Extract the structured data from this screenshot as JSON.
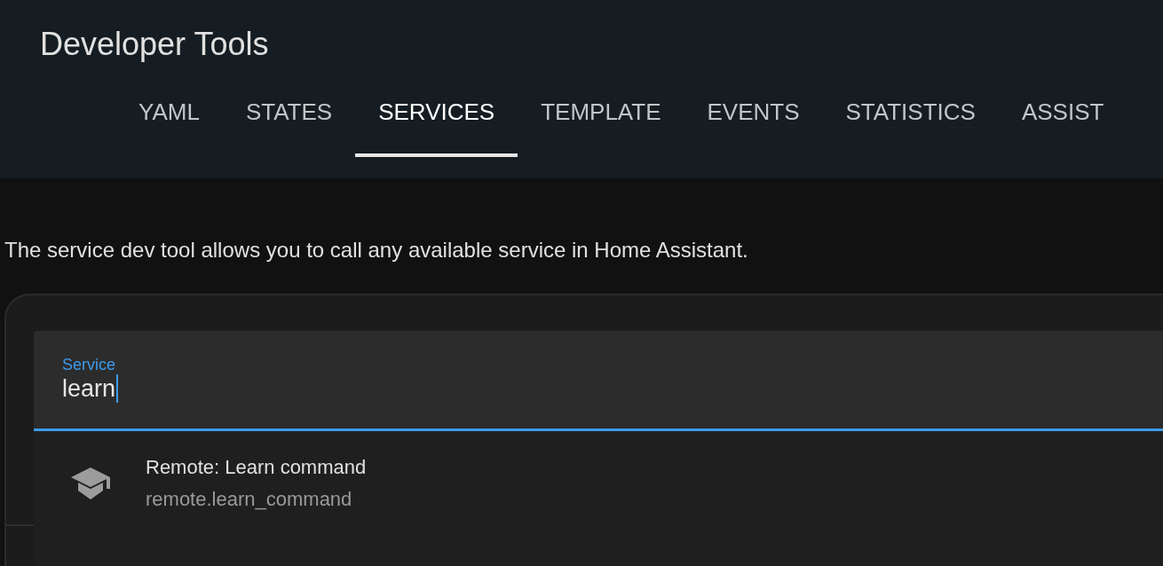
{
  "header": {
    "title": "Developer Tools"
  },
  "tabs": [
    {
      "label": "YAML",
      "selected": false
    },
    {
      "label": "STATES",
      "selected": false
    },
    {
      "label": "SERVICES",
      "selected": true
    },
    {
      "label": "TEMPLATE",
      "selected": false
    },
    {
      "label": "EVENTS",
      "selected": false
    },
    {
      "label": "STATISTICS",
      "selected": false
    },
    {
      "label": "ASSIST",
      "selected": false
    }
  ],
  "description": "The service dev tool allows you to call any available service in Home Assistant.",
  "service_field": {
    "label": "Service",
    "value": "learn",
    "focused": true
  },
  "suggestions": [
    {
      "title": "Remote: Learn command",
      "subtitle": "remote.learn_command"
    }
  ]
}
